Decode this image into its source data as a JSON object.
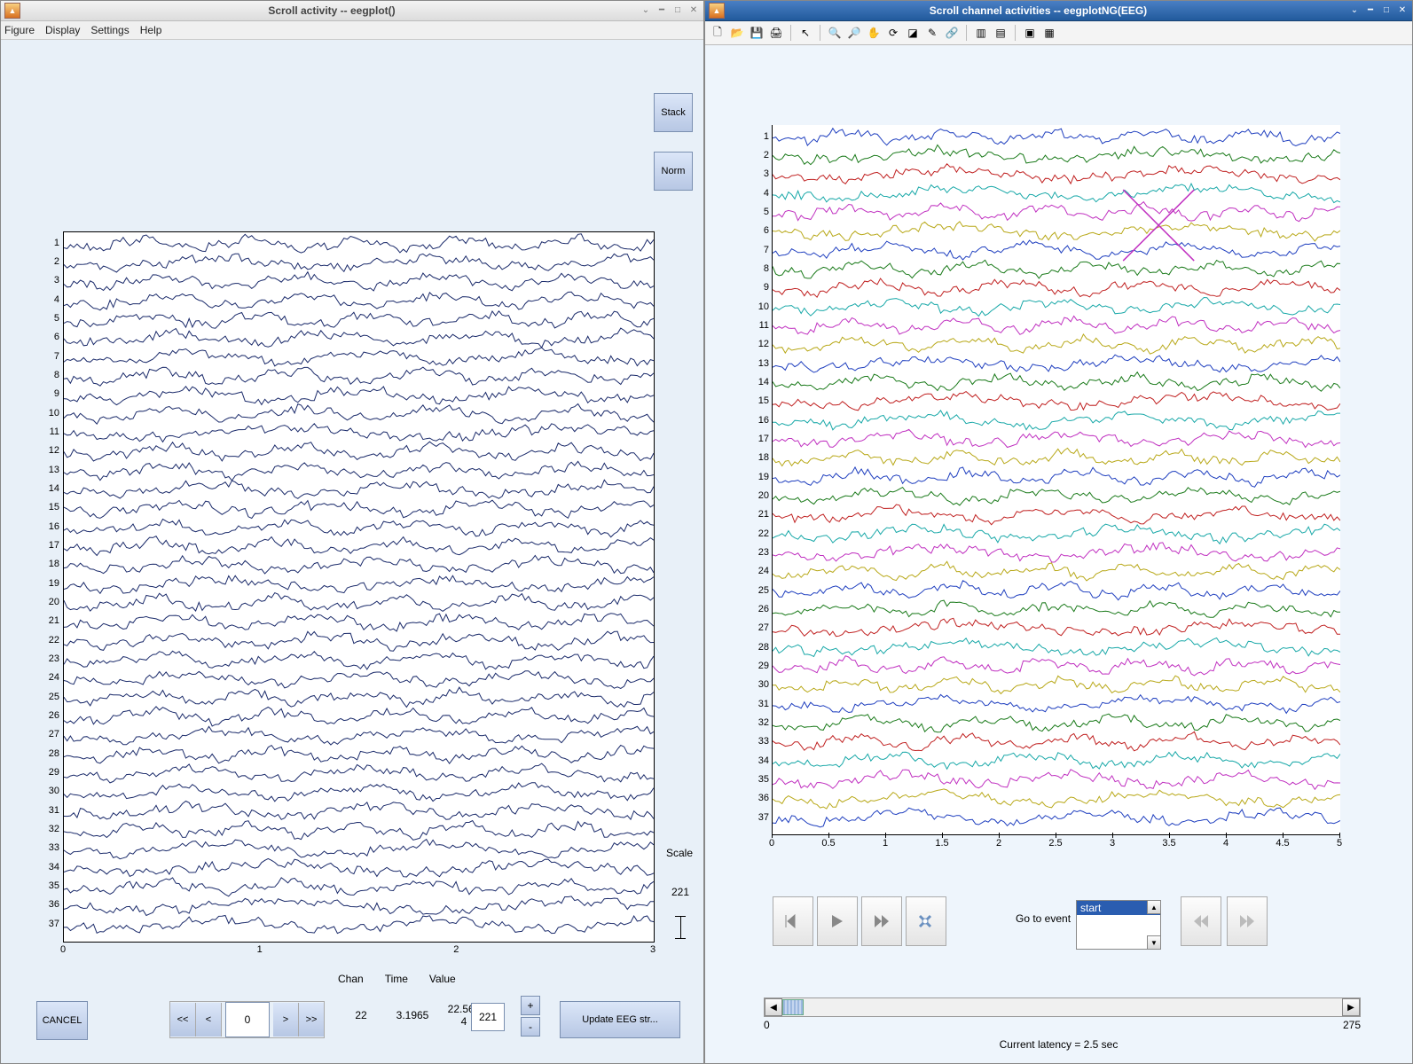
{
  "left_window": {
    "title": "Scroll activity -- eegplot()",
    "menu": [
      "Figure",
      "Display",
      "Settings",
      "Help"
    ],
    "win_controls": [
      "collapse",
      "minimize",
      "maximize",
      "close"
    ],
    "side_buttons": {
      "stack": "Stack",
      "norm": "Norm"
    },
    "channel_count": 37,
    "x_ticks": [
      "0",
      "1",
      "2",
      "3"
    ],
    "scale_label": "Scale",
    "scale_readout": "221",
    "headers": [
      "Chan",
      "Time",
      "Value"
    ],
    "readout": {
      "chan": "22",
      "time": "3.1965",
      "value": "22.564\n4",
      "scale": "221"
    },
    "pos_value": "0",
    "nav": {
      "first": "<<",
      "prev": "<",
      "next": ">",
      "last": ">>"
    },
    "scale_adj": {
      "plus": "+",
      "minus": "-"
    },
    "cancel": "CANCEL",
    "update": "Update EEG str..."
  },
  "right_window": {
    "title": "Scroll channel activities -- eegplotNG(EEG)",
    "win_controls": [
      "collapse",
      "minimize",
      "maximize",
      "close"
    ],
    "toolbar_icons": [
      "new-file",
      "open-file",
      "save",
      "print",
      "arrow",
      "zoom-in",
      "zoom-out",
      "pan",
      "rotate",
      "data-cursor",
      "brush",
      "link",
      "sep",
      "insert-colorbar",
      "insert-legend",
      "sep",
      "layout-1",
      "layout-2"
    ],
    "channel_count": 37,
    "highlighted_channel": 5,
    "x_ticks": [
      "0",
      "0.5",
      "1",
      "1.5",
      "2",
      "2.5",
      "3",
      "3.5",
      "4",
      "4.5",
      "5"
    ],
    "goto_label": "Go to event",
    "goto_options": [
      "start"
    ],
    "scroll": {
      "min": "0",
      "max": "275"
    },
    "latency": "Current latency = 2.5 sec",
    "channel_colors": [
      "#1f3fbf",
      "#1a7a1a",
      "#c02020",
      "#18a8a8",
      "#c030c0",
      "#b8a818",
      "#1f3fbf",
      "#1a7a1a",
      "#c02020",
      "#18a8a8",
      "#c030c0",
      "#b8a818",
      "#1f3fbf",
      "#1a7a1a",
      "#c02020",
      "#18a8a8",
      "#c030c0",
      "#b8a818",
      "#1f3fbf",
      "#1a7a1a",
      "#c02020",
      "#18a8a8",
      "#c030c0",
      "#b8a818",
      "#1f3fbf",
      "#1a7a1a",
      "#c02020",
      "#18a8a8",
      "#c030c0",
      "#b8a818",
      "#1f3fbf",
      "#1a7a1a",
      "#c02020",
      "#18a8a8",
      "#c030c0",
      "#b8a818",
      "#1f3fbf"
    ]
  }
}
